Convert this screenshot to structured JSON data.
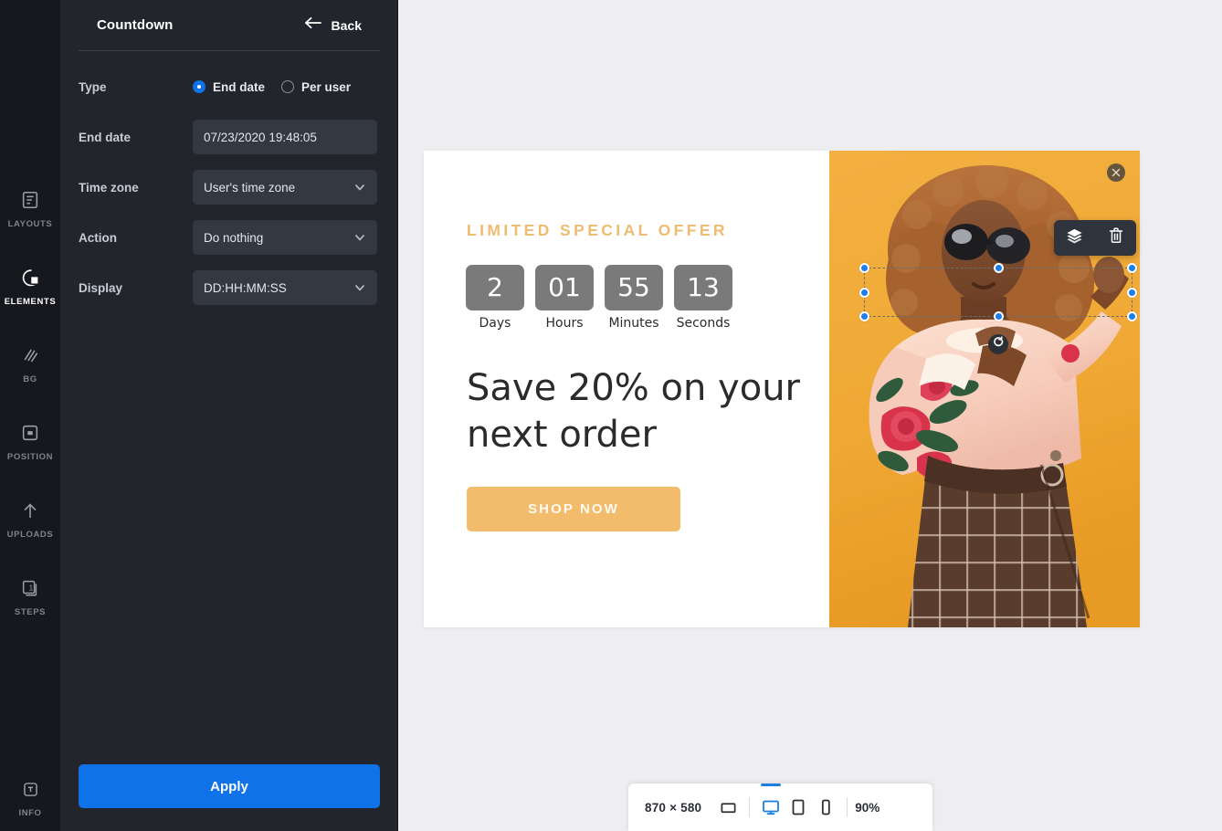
{
  "rail": {
    "items": [
      {
        "label": "LAYOUTS",
        "icon": "layouts-icon",
        "active": false
      },
      {
        "label": "ELEMENTS",
        "icon": "elements-icon",
        "active": true
      },
      {
        "label": "BG",
        "icon": "bg-icon",
        "active": false
      },
      {
        "label": "POSITION",
        "icon": "position-icon",
        "active": false
      },
      {
        "label": "UPLOADS",
        "icon": "uploads-icon",
        "active": false
      },
      {
        "label": "STEPS",
        "icon": "steps-icon",
        "active": false
      }
    ],
    "info": {
      "label": "INFO",
      "icon": "info-text-icon"
    }
  },
  "panel": {
    "title": "Countdown",
    "back_label": "Back",
    "rows": {
      "type": {
        "label": "Type",
        "options": [
          {
            "label": "End date",
            "selected": true
          },
          {
            "label": "Per user",
            "selected": false
          }
        ]
      },
      "end_date": {
        "label": "End date",
        "value": "07/23/2020 19:48:05"
      },
      "time_zone": {
        "label": "Time zone",
        "value": "User's time zone"
      },
      "action": {
        "label": "Action",
        "value": "Do nothing"
      },
      "display": {
        "label": "Display",
        "value": "DD:HH:MM:SS"
      }
    },
    "apply_label": "Apply"
  },
  "popup": {
    "eyebrow": "LIMITED SPECIAL OFFER",
    "headline": "Save 20% on your next order",
    "cta_label": "SHOP NOW",
    "countdown": [
      {
        "value": "2",
        "label": "Days"
      },
      {
        "value": "01",
        "label": "Hours"
      },
      {
        "value": "55",
        "label": "Minutes"
      },
      {
        "value": "13",
        "label": "Seconds"
      }
    ],
    "close_icon": "close-icon",
    "colors": {
      "eyebrow": "#eebc72",
      "cta_bg": "#f2bc6c",
      "photo_bg": "#f0ab36",
      "countdown_box": "#7a7a7a"
    }
  },
  "float_toolbar": {
    "buttons": [
      {
        "icon": "layers-icon",
        "name": "layers-button"
      },
      {
        "icon": "trash-icon",
        "name": "delete-button"
      }
    ]
  },
  "bottom_bar": {
    "dimensions": "870 × 580",
    "zoom": "90%",
    "devices": [
      {
        "icon": "fullscreen-icon",
        "active": false
      },
      {
        "icon": "desktop-icon",
        "active": true
      },
      {
        "icon": "tablet-icon",
        "active": false
      },
      {
        "icon": "mobile-icon",
        "active": false
      }
    ]
  }
}
